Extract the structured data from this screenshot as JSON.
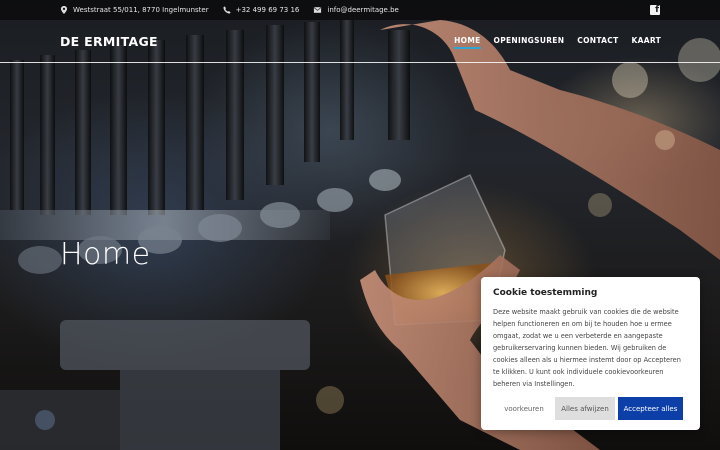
{
  "topbar": {
    "address": "Weststraat 55/011, 8770 Ingelmunster",
    "phone": "+32 499 69 73 16",
    "email": "info@deermitage.be",
    "icons": {
      "address": "map-marker-icon",
      "phone": "phone-icon",
      "email": "envelope-icon",
      "social": "facebook-icon"
    },
    "social_label": "f"
  },
  "header": {
    "brand": "DE ERMITAGE",
    "nav": [
      {
        "label": "HOME",
        "active": true
      },
      {
        "label": "OPENINGSUREN",
        "active": false
      },
      {
        "label": "CONTACT",
        "active": false
      },
      {
        "label": "KAART",
        "active": false
      }
    ]
  },
  "hero": {
    "title": "Home"
  },
  "cookie": {
    "title": "Cookie toestemming",
    "body": "Deze website maakt gebruik van cookies die de website helpen functioneren en om bij te houden hoe u ermee omgaat, zodat we u een verbeterde en aangepaste gebruikerservaring kunnen bieden. Wij gebruiken de cookies alleen als u hiermee instemt door op Accepteren te klikken. U kunt ook individuele cookievoorkeuren beheren via Instellingen.",
    "preferences_label": "voorkeuren",
    "reject_label": "Alles afwijzen",
    "accept_label": "Accepteer alles"
  },
  "colors": {
    "accent": "#2fa6d6",
    "accept_button": "#0c3fa8",
    "reject_button": "#dedede"
  }
}
